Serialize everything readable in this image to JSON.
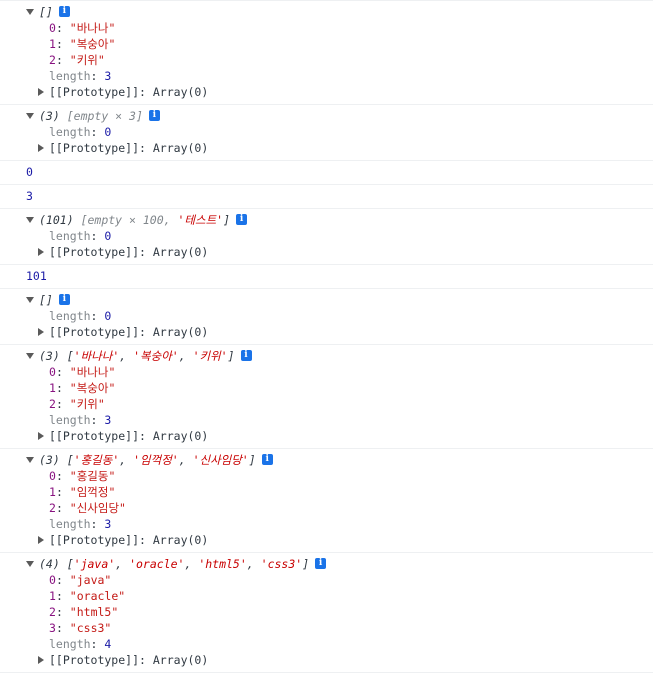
{
  "proto_label": "[[Prototype]]",
  "proto_value": "Array(0)",
  "length_key": "length",
  "info_glyph": "i",
  "entries": [
    {
      "kind": "array",
      "head": "[]",
      "items": [
        {
          "k": "0",
          "v": "\"바나나\""
        },
        {
          "k": "1",
          "v": "\"복숭아\""
        },
        {
          "k": "2",
          "v": "\"키위\""
        }
      ],
      "length": "3"
    },
    {
      "kind": "array",
      "head_count": "(3)",
      "head": "[empty × 3]",
      "items": [],
      "length": "0"
    },
    {
      "kind": "value",
      "value": "0"
    },
    {
      "kind": "value",
      "value": "3"
    },
    {
      "kind": "array",
      "head_count": "(101)",
      "head_empty": "[empty × 100, ",
      "head_str": "'테스트'",
      "head_close": "]",
      "items": [],
      "length": "0"
    },
    {
      "kind": "value",
      "value": "101"
    },
    {
      "kind": "array",
      "head": "[]",
      "items": [],
      "length": "0"
    },
    {
      "kind": "array",
      "head_count": "(3)",
      "head_strs": [
        "'바나나'",
        "'복숭아'",
        "'키위'"
      ],
      "items": [
        {
          "k": "0",
          "v": "\"바나나\""
        },
        {
          "k": "1",
          "v": "\"복숭아\""
        },
        {
          "k": "2",
          "v": "\"키위\""
        }
      ],
      "length": "3"
    },
    {
      "kind": "array",
      "head_count": "(3)",
      "head_strs": [
        "'홍길동'",
        "'임꺽정'",
        "'신사임당'"
      ],
      "items": [
        {
          "k": "0",
          "v": "\"홍길동\""
        },
        {
          "k": "1",
          "v": "\"임꺽정\""
        },
        {
          "k": "2",
          "v": "\"신사임당\""
        }
      ],
      "length": "3"
    },
    {
      "kind": "array",
      "head_count": "(4)",
      "head_strs": [
        "'java'",
        "'oracle'",
        "'html5'",
        "'css3'"
      ],
      "items": [
        {
          "k": "0",
          "v": "\"java\""
        },
        {
          "k": "1",
          "v": "\"oracle\""
        },
        {
          "k": "2",
          "v": "\"html5\""
        },
        {
          "k": "3",
          "v": "\"css3\""
        }
      ],
      "length": "4"
    }
  ]
}
